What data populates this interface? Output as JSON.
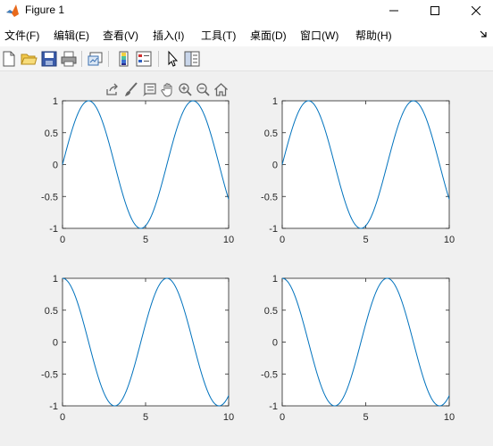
{
  "window": {
    "title": "Figure 1",
    "controls": [
      "minimize",
      "maximize",
      "close"
    ]
  },
  "menubar": {
    "items": [
      {
        "label": "文件(F)"
      },
      {
        "label": "编辑(E)"
      },
      {
        "label": "查看(V)"
      },
      {
        "label": "插入(I)"
      },
      {
        "label": "工具(T)"
      },
      {
        "label": "桌面(D)"
      },
      {
        "label": "窗口(W)"
      },
      {
        "label": "帮助(H)"
      }
    ],
    "overflow_icon": "dock-arrow-icon"
  },
  "toolbar": {
    "buttons": [
      "new-figure-icon",
      "open-file-icon",
      "save-icon",
      "print-icon",
      "link-plot-icon",
      "insert-colorbar-icon",
      "insert-legend-icon",
      "edit-plot-icon",
      "property-inspector-icon"
    ]
  },
  "axes_toolbar": {
    "buttons": [
      "export-icon",
      "brush-icon",
      "data-tips-icon",
      "pan-icon",
      "zoom-in-icon",
      "zoom-out-icon",
      "home-icon"
    ]
  },
  "colors": {
    "line": "#0072BD",
    "axes_background": "#ffffff",
    "figure_background": "#f0f0f0",
    "tick_text": "#262626"
  },
  "chart_data": [
    {
      "type": "line",
      "position": "top-left",
      "function": "sin(x)",
      "x_range": [
        0,
        10
      ],
      "xlim": [
        0,
        10
      ],
      "ylim": [
        -1,
        1
      ],
      "xticks": [
        "0",
        "5",
        "10"
      ],
      "yticks": [
        "1",
        "0.5",
        "0",
        "-0.5",
        "-1"
      ],
      "series": [
        {
          "x": [
            0,
            1.57,
            3.14,
            4.71,
            6.28,
            7.85,
            9.42,
            10
          ],
          "y": [
            0,
            1,
            0,
            -1,
            0,
            1,
            0,
            -0.544
          ]
        }
      ]
    },
    {
      "type": "line",
      "position": "top-right",
      "function": "sin(x)",
      "x_range": [
        0,
        10
      ],
      "xlim": [
        0,
        10
      ],
      "ylim": [
        -1,
        1
      ],
      "xticks": [
        "0",
        "5",
        "10"
      ],
      "yticks": [
        "1",
        "0.5",
        "0",
        "-0.5",
        "-1"
      ],
      "series": [
        {
          "x": [
            0,
            1.57,
            3.14,
            4.71,
            6.28,
            7.85,
            9.42,
            10
          ],
          "y": [
            0,
            1,
            0,
            -1,
            0,
            1,
            0,
            -0.544
          ]
        }
      ]
    },
    {
      "type": "line",
      "position": "bottom-left",
      "function": "cos(x)",
      "x_range": [
        0,
        10
      ],
      "xlim": [
        0,
        10
      ],
      "ylim": [
        -1,
        1
      ],
      "xticks": [
        "0",
        "5",
        "10"
      ],
      "yticks": [
        "1",
        "0.5",
        "0",
        "-0.5",
        "-1"
      ],
      "series": [
        {
          "x": [
            0,
            1.57,
            3.14,
            4.71,
            6.28,
            7.85,
            9.42,
            10
          ],
          "y": [
            1,
            0,
            -1,
            0,
            1,
            0,
            -1,
            -0.839
          ]
        }
      ]
    },
    {
      "type": "line",
      "position": "bottom-right",
      "function": "cos(x)",
      "x_range": [
        0,
        10
      ],
      "xlim": [
        0,
        10
      ],
      "ylim": [
        -1,
        1
      ],
      "xticks": [
        "0",
        "5",
        "10"
      ],
      "yticks": [
        "1",
        "0.5",
        "0",
        "-0.5",
        "-1"
      ],
      "series": [
        {
          "x": [
            0,
            1.57,
            3.14,
            4.71,
            6.28,
            7.85,
            9.42,
            10
          ],
          "y": [
            1,
            0,
            -1,
            0,
            1,
            0,
            -1,
            -0.839
          ]
        }
      ]
    }
  ]
}
